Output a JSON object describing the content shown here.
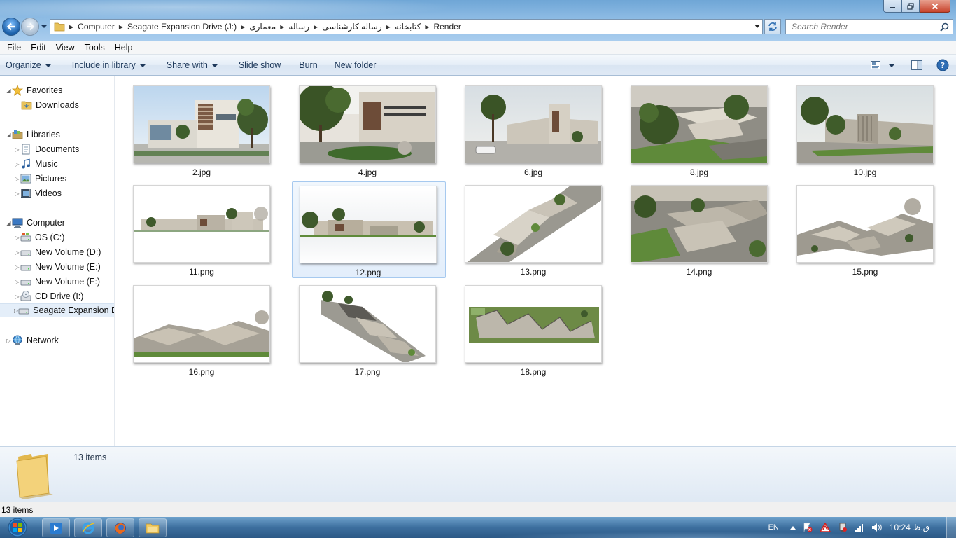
{
  "window": {
    "address": {
      "crumbs": [
        "Computer",
        "Seagate Expansion Drive (J:)",
        "معماری",
        "رساله",
        "رساله کارشناسی",
        "کتابخانه",
        "Render"
      ]
    },
    "search": {
      "placeholder": "Search Render"
    }
  },
  "menubar": {
    "items": [
      "File",
      "Edit",
      "View",
      "Tools",
      "Help"
    ]
  },
  "toolbar": {
    "organize": "Organize",
    "include_in_library": "Include in library",
    "share_with": "Share with",
    "slide_show": "Slide show",
    "burn": "Burn",
    "new_folder": "New folder"
  },
  "nav": {
    "favorites": "Favorites",
    "downloads": "Downloads",
    "libraries": "Libraries",
    "documents": "Documents",
    "music": "Music",
    "pictures": "Pictures",
    "videos": "Videos",
    "computer": "Computer",
    "drive_c": "OS (C:)",
    "drive_d": "New Volume (D:)",
    "drive_e": "New Volume (E:)",
    "drive_f": "New Volume (F:)",
    "drive_i": "CD Drive (I:)",
    "drive_j": "Seagate Expansion Dr",
    "network": "Network"
  },
  "files": [
    {
      "name": "2.jpg",
      "scene": "building-front"
    },
    {
      "name": "4.jpg",
      "scene": "building-trees"
    },
    {
      "name": "6.jpg",
      "scene": "building-street"
    },
    {
      "name": "8.jpg",
      "scene": "aerial-green"
    },
    {
      "name": "10.jpg",
      "scene": "building-wall"
    },
    {
      "name": "11.png",
      "scene": "elevation-thin"
    },
    {
      "name": "12.png",
      "scene": "elevation",
      "selected": true
    },
    {
      "name": "13.png",
      "scene": "axonometric-diagonal"
    },
    {
      "name": "14.png",
      "scene": "aerial-roofs"
    },
    {
      "name": "15.png",
      "scene": "aerial-zigzag"
    },
    {
      "name": "16.png",
      "scene": "perspective-low"
    },
    {
      "name": "17.png",
      "scene": "axonometric-diagonal-2"
    },
    {
      "name": "18.png",
      "scene": "plan-top"
    }
  ],
  "details": {
    "count": "13 items"
  },
  "statusbar": {
    "text": "13 items"
  },
  "taskbar": {
    "language": "EN",
    "clock": "10:24 ق.ظ"
  },
  "colors": {
    "accent": "#1e395b",
    "selection": "#a6c9ef",
    "titlebar": "#8dbbe4",
    "taskbar": "#3d6f9e"
  }
}
